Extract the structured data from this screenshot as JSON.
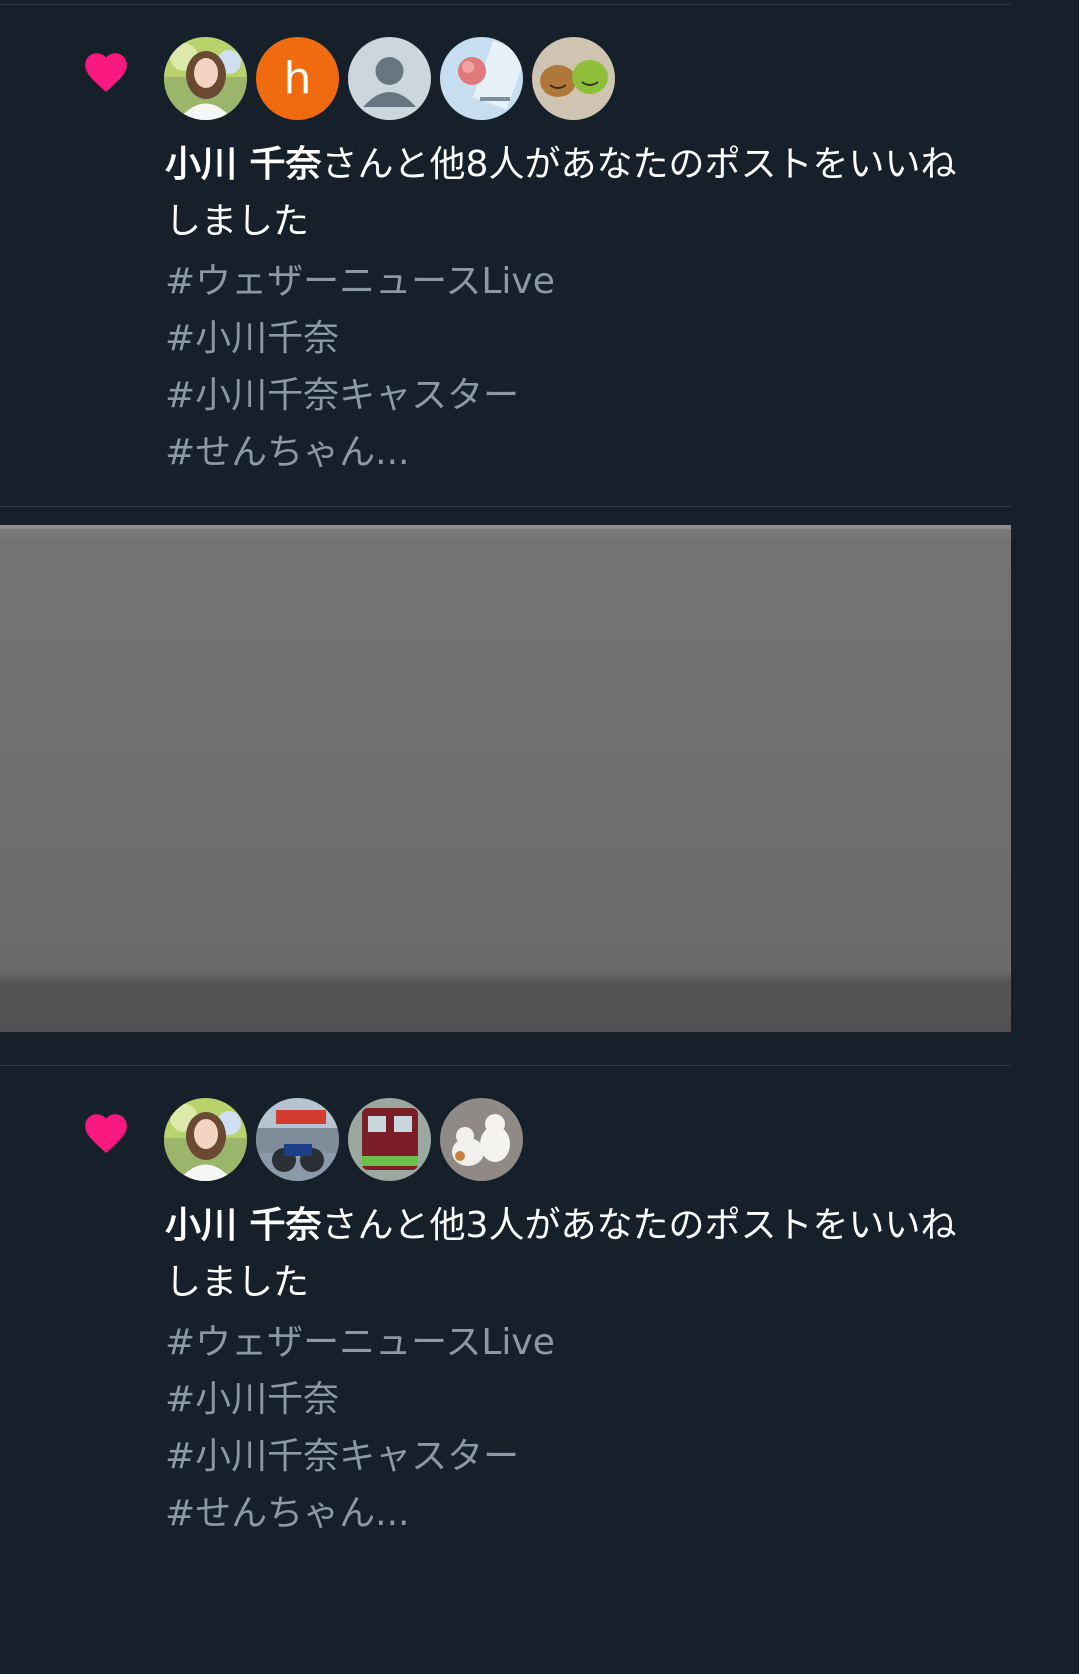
{
  "colors": {
    "background": "#15202b",
    "heart": "#f91880",
    "primary_text": "#ffffff",
    "secondary_text": "#8b98a5",
    "orange_avatar": "#f06a0f",
    "gray_block": "#6f6f6f"
  },
  "notifications": [
    {
      "icon": "heart-icon",
      "avatars": [
        {
          "kind": "photo",
          "icon": "woman-portrait-avatar"
        },
        {
          "kind": "letter",
          "letter": "h",
          "color": "#f06a0f"
        },
        {
          "kind": "default",
          "icon": "default-user-avatar"
        },
        {
          "kind": "photo",
          "icon": "anime-character-avatar"
        },
        {
          "kind": "photo",
          "icon": "plush-toys-avatar"
        }
      ],
      "name": "小川 千奈",
      "message": "さんと他8人があなたのポストをいいねしました",
      "hashtags": [
        "#ウェザーニュースLive",
        "#小川千奈",
        "#小川千奈キャスター",
        "#せんちゃん..."
      ]
    },
    {
      "icon": "heart-icon",
      "avatars": [
        {
          "kind": "photo",
          "icon": "woman-portrait-avatar"
        },
        {
          "kind": "photo",
          "icon": "motorcycle-shop-avatar"
        },
        {
          "kind": "photo",
          "icon": "train-avatar"
        },
        {
          "kind": "photo",
          "icon": "cats-avatar"
        }
      ],
      "name": "小川 千奈",
      "message": "さんと他3人があなたのポストをいいねしました",
      "hashtags": [
        "#ウェザーニュースLive",
        "#小川千奈",
        "#小川千奈キャスター",
        "#せんちゃん..."
      ]
    }
  ]
}
